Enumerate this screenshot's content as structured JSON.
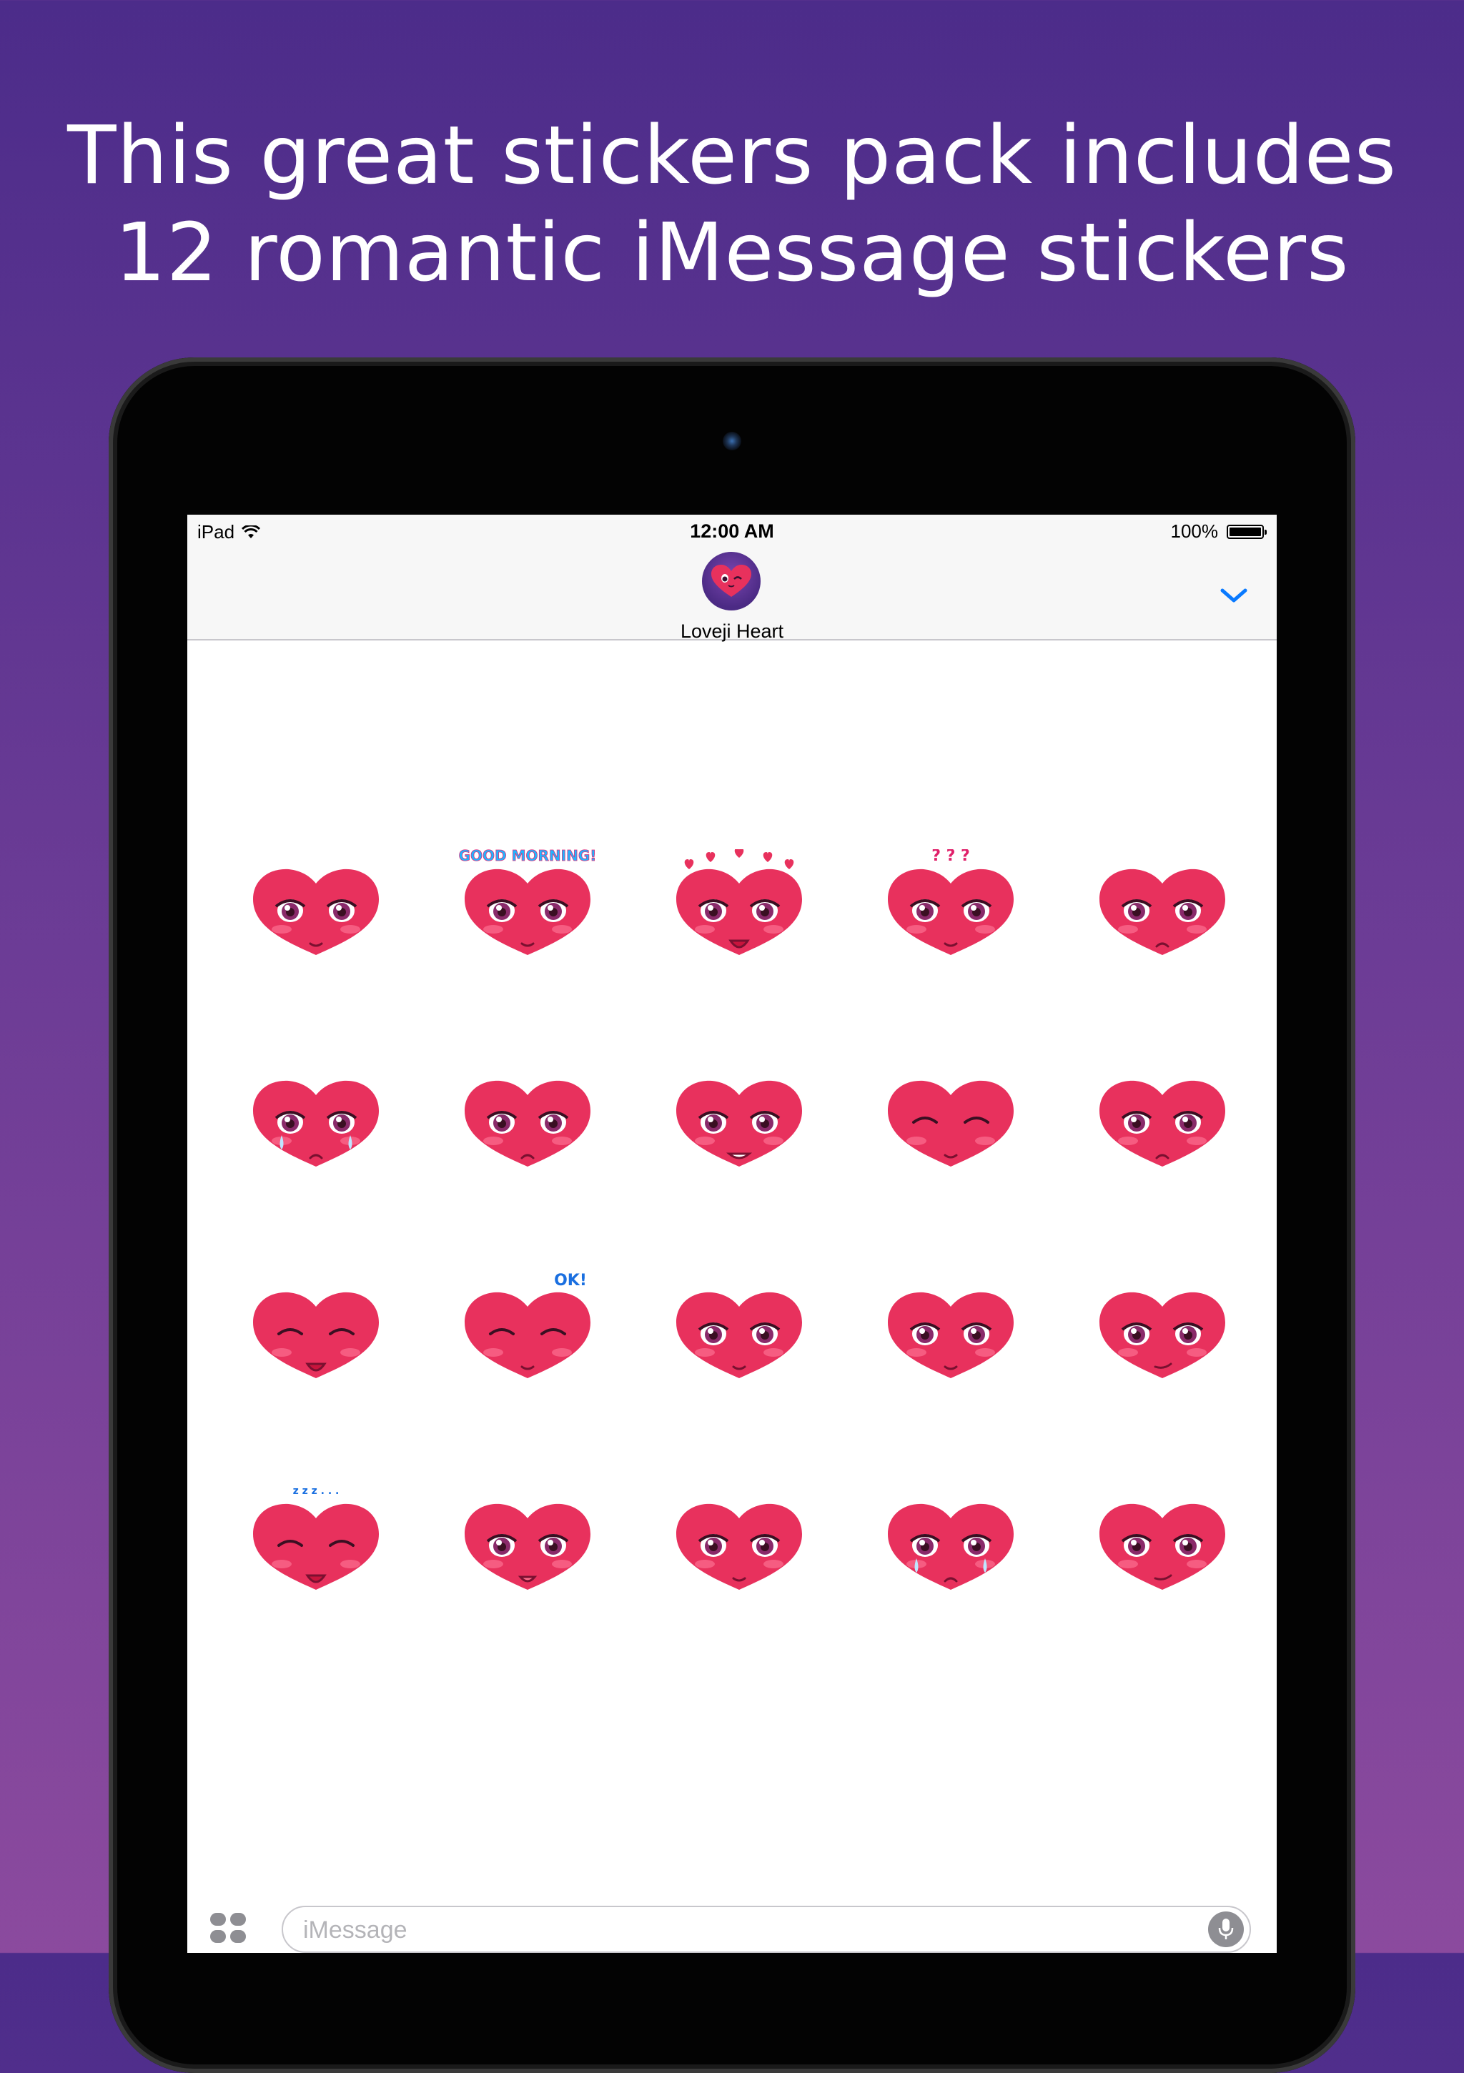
{
  "headline": {
    "line1": "This great stickers pack includes",
    "line2": "12 romantic iMessage stickers"
  },
  "status_bar": {
    "device": "iPad",
    "time": "12:00 AM",
    "battery": "100%",
    "wifi_icon": "wifi-icon",
    "battery_icon": "battery-icon"
  },
  "nav": {
    "app_name": "Loveji Heart",
    "collapse_icon": "chevron-down-icon"
  },
  "stickers": [
    {
      "name": "heart-smile-sticker",
      "mood": "smile",
      "caption": ""
    },
    {
      "name": "heart-good-morning-sticker",
      "mood": "morning",
      "caption": "GOOD MORNING!"
    },
    {
      "name": "heart-in-love-sticker",
      "mood": "love",
      "caption": ""
    },
    {
      "name": "heart-confused-sticker",
      "mood": "confused",
      "caption": "? ? ?"
    },
    {
      "name": "heart-worried-sticker",
      "mood": "worried",
      "caption": ""
    },
    {
      "name": "heart-crying-sticker",
      "mood": "crying",
      "caption": ""
    },
    {
      "name": "heart-sad-sticker",
      "mood": "sad",
      "caption": ""
    },
    {
      "name": "heart-grin-sticker",
      "mood": "grin",
      "caption": ""
    },
    {
      "name": "heart-shy-hands-sticker",
      "mood": "shy",
      "caption": ""
    },
    {
      "name": "heart-pout-sticker",
      "mood": "pout",
      "caption": ""
    },
    {
      "name": "heart-laughing-sticker",
      "mood": "laugh",
      "caption": ""
    },
    {
      "name": "heart-ok-sticker",
      "mood": "ok",
      "caption": "OK!"
    },
    {
      "name": "heart-stare-sticker",
      "mood": "stare",
      "caption": ""
    },
    {
      "name": "heart-praying-sticker",
      "mood": "pray",
      "caption": ""
    },
    {
      "name": "heart-suspicious-sticker",
      "mood": "suspicious",
      "caption": ""
    },
    {
      "name": "heart-sleepy-sticker",
      "mood": "sleepy",
      "caption": "z z z . . ."
    },
    {
      "name": "heart-tongue-sticker",
      "mood": "tongue",
      "caption": ""
    },
    {
      "name": "heart-headpat-sticker",
      "mood": "headpat",
      "caption": ""
    },
    {
      "name": "heart-teary-sticker",
      "mood": "teary",
      "caption": ""
    },
    {
      "name": "heart-smirk-sticker",
      "mood": "smirk",
      "caption": ""
    }
  ],
  "input": {
    "placeholder": "iMessage",
    "apps_icon": "app-drawer-icon",
    "mic_icon": "microphone-icon"
  },
  "colors": {
    "background_top": "#4c2c8a",
    "background_bottom": "#8b4a9e",
    "heart": "#e8315d",
    "accent": "#0a7aff"
  }
}
